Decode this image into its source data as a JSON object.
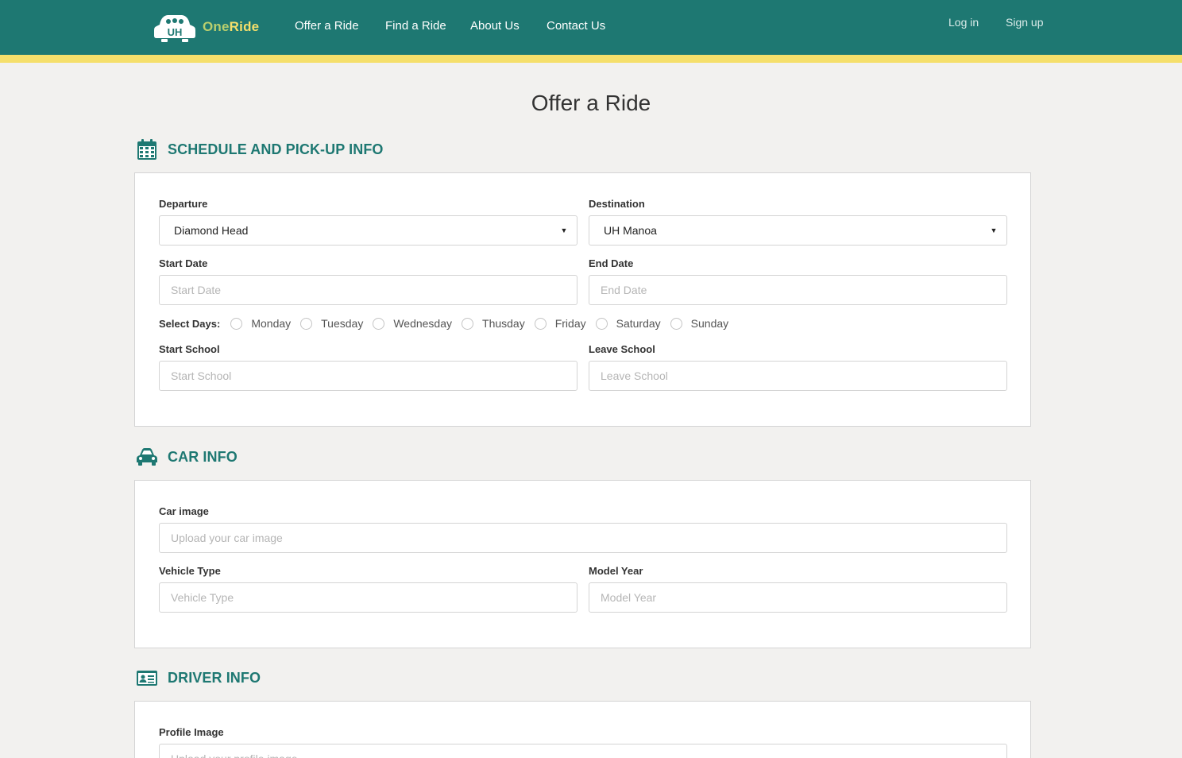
{
  "header": {
    "brand_logo_text": "UH",
    "brand_prefix": "One",
    "brand_suffix": "Ride",
    "nav": [
      "Offer a Ride",
      "Find a Ride",
      "About Us",
      "Contact Us"
    ],
    "login": "Log in",
    "signup": "Sign up"
  },
  "page_title": "Offer a Ride",
  "schedule": {
    "title": "SCHEDULE AND PICK-UP INFO",
    "departure_label": "Departure",
    "departure_value": "Diamond Head",
    "destination_label": "Destination",
    "destination_value": "UH Manoa",
    "start_date_label": "Start Date",
    "start_date_placeholder": "Start Date",
    "end_date_label": "End Date",
    "end_date_placeholder": "End Date",
    "days_label": "Select Days:",
    "days": [
      "Monday",
      "Tuesday",
      "Wednesday",
      "Thusday",
      "Friday",
      "Saturday",
      "Sunday"
    ],
    "start_school_label": "Start School",
    "start_school_placeholder": "Start School",
    "leave_school_label": "Leave School",
    "leave_school_placeholder": "Leave School"
  },
  "car": {
    "title": "CAR INFO",
    "image_label": "Car image",
    "image_placeholder": "Upload your car image",
    "vehicle_type_label": "Vehicle Type",
    "vehicle_type_placeholder": "Vehicle Type",
    "model_year_label": "Model Year",
    "model_year_placeholder": "Model Year"
  },
  "driver": {
    "title": "DRIVER INFO",
    "profile_label": "Profile Image",
    "profile_placeholder": "Upload your profile image"
  },
  "colors": {
    "primary": "#1e7872",
    "accent": "#f5df6b",
    "background": "#f2f1ef"
  }
}
